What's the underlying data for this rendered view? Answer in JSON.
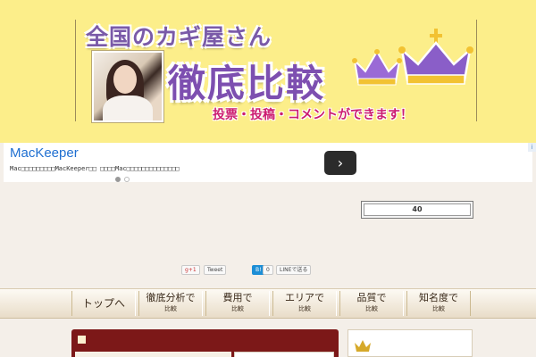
{
  "header": {
    "site_title": "全国のカギ屋さん",
    "main_title": "徹底比較",
    "subtitle": "投票・投稿・コメントができます！",
    "colors": {
      "background": "#fcee8a",
      "title_purple": "#7d4fb0",
      "subtitle_pink": "#cc1d70"
    }
  },
  "ad": {
    "brand": "MacKeeper",
    "text": "Mac□□□□□□□□□MacKeeper□□ □□□□Mac□□□□□□□□□□□□□□",
    "next_icon": "›",
    "info_icon": "i",
    "dots_count": 2
  },
  "counter": {
    "value": "40"
  },
  "share": {
    "gplus": "g+1",
    "tweet": "Tweet",
    "hatena": "B!",
    "hatena_count": "0",
    "line": "LINEで送る"
  },
  "nav": {
    "items": [
      {
        "line1": "トップへ",
        "line2": ""
      },
      {
        "line1": "徹底分析で",
        "line2": "比較"
      },
      {
        "line1": "費用で",
        "line2": "比較"
      },
      {
        "line1": "エリアで",
        "line2": "比較"
      },
      {
        "line1": "品質で",
        "line2": "比較"
      },
      {
        "line1": "知名度で",
        "line2": "比較"
      }
    ]
  },
  "content": {
    "bar_color": "#7c1818"
  }
}
